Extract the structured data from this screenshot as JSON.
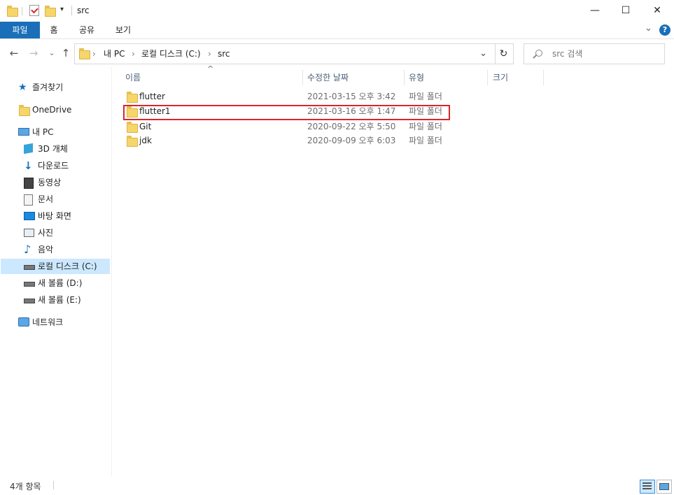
{
  "window": {
    "title": "src",
    "minimize": "—",
    "maximize": "☐",
    "close": "✕"
  },
  "ribbon": {
    "tabs": [
      "파일",
      "홈",
      "공유",
      "보기"
    ],
    "expand": "⌄",
    "help": "?"
  },
  "nav": {
    "back": "←",
    "forward": "→",
    "recent": "⌄",
    "up": "↑",
    "breadcrumb": [
      "내 PC",
      "로컬 디스크 (C:)",
      "src"
    ],
    "separator": "›",
    "dropdown": "⌄",
    "refresh": "↻",
    "search_placeholder": "src 검색"
  },
  "sidebar": {
    "items": [
      {
        "label": "즐겨찾기",
        "icon": "star-icon"
      },
      {
        "label": "OneDrive",
        "icon": "folder-icon"
      },
      {
        "label": "내 PC",
        "icon": "computer-icon"
      },
      {
        "label": "3D 개체",
        "icon": "cube-icon"
      },
      {
        "label": "다운로드",
        "icon": "download-icon"
      },
      {
        "label": "동영상",
        "icon": "video-icon"
      },
      {
        "label": "문서",
        "icon": "document-icon"
      },
      {
        "label": "바탕 화면",
        "icon": "desktop-icon"
      },
      {
        "label": "사진",
        "icon": "picture-icon"
      },
      {
        "label": "음악",
        "icon": "music-icon"
      },
      {
        "label": "로컬 디스크 (C:)",
        "icon": "drive-icon"
      },
      {
        "label": "새 볼륨 (D:)",
        "icon": "drive-icon"
      },
      {
        "label": "새 볼륨 (E:)",
        "icon": "drive-icon"
      },
      {
        "label": "네트워크",
        "icon": "network-icon"
      }
    ]
  },
  "columns": {
    "name": "이름",
    "date": "수정한 날짜",
    "type": "유형",
    "size": "크기",
    "sort_indicator": "^"
  },
  "files": [
    {
      "name": "flutter",
      "date": "2021-03-15 오후 3:42",
      "type": "파일 폴더"
    },
    {
      "name": "flutter1",
      "date": "2021-03-16 오후 1:47",
      "type": "파일 폴더"
    },
    {
      "name": "Git",
      "date": "2020-09-22 오후 5:50",
      "type": "파일 폴더"
    },
    {
      "name": "jdk",
      "date": "2020-09-09 오후 6:03",
      "type": "파일 폴더"
    }
  ],
  "status": {
    "count": "4개 항목"
  },
  "colors": {
    "accent": "#1a6fb8",
    "highlight": "#d9262b",
    "folder": "#f6d56b"
  }
}
